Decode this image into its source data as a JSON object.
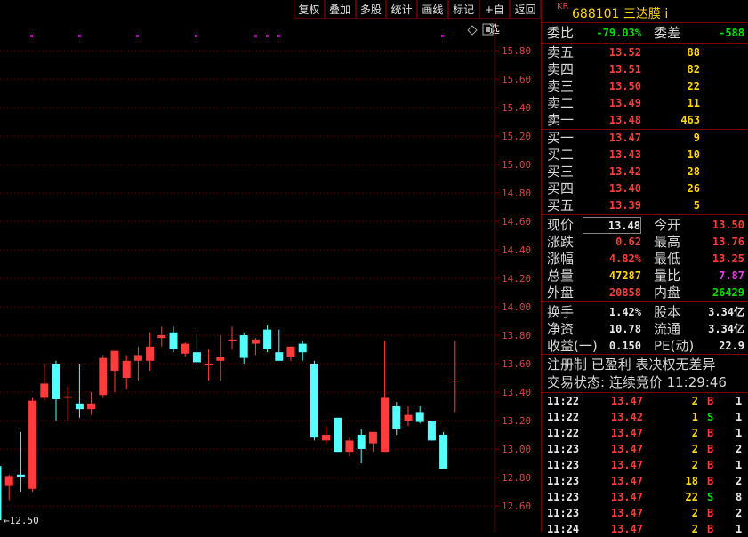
{
  "toolbar": {
    "buttons": [
      "复权",
      "叠加",
      "多股",
      "统计",
      "画线",
      "标记",
      "+自选",
      "返回"
    ]
  },
  "colors": {
    "up": "#ff3b3b",
    "down": "#54ffff",
    "grid": "#7a0000",
    "marker": "#c000c0"
  },
  "chart_data": {
    "type": "candlestick",
    "y_axis_labels": [
      "15.80",
      "15.60",
      "15.40",
      "15.20",
      "15.00",
      "14.80",
      "14.60",
      "14.40",
      "14.20",
      "14.00",
      "13.80",
      "13.60",
      "13.40",
      "13.20",
      "13.00",
      "12.80",
      "12.60"
    ],
    "ylim": [
      12.5,
      15.9
    ],
    "low_marker": "12.50",
    "candles": [
      {
        "o": 12.88,
        "h": 13.2,
        "l": 12.7,
        "c": 12.5
      },
      {
        "o": 12.74,
        "h": 12.82,
        "l": 12.64,
        "c": 12.81
      },
      {
        "o": 12.82,
        "h": 13.12,
        "l": 12.7,
        "c": 12.8
      },
      {
        "o": 12.72,
        "h": 13.36,
        "l": 12.7,
        "c": 13.34
      },
      {
        "o": 13.36,
        "h": 13.6,
        "l": 13.34,
        "c": 13.46
      },
      {
        "o": 13.6,
        "h": 13.62,
        "l": 13.2,
        "c": 13.35
      },
      {
        "o": 13.36,
        "h": 13.44,
        "l": 13.2,
        "c": 13.37
      },
      {
        "o": 13.32,
        "h": 13.6,
        "l": 13.22,
        "c": 13.28
      },
      {
        "o": 13.28,
        "h": 13.4,
        "l": 13.24,
        "c": 13.32
      },
      {
        "o": 13.38,
        "h": 13.66,
        "l": 13.36,
        "c": 13.64
      },
      {
        "o": 13.55,
        "h": 13.68,
        "l": 13.4,
        "c": 13.69
      },
      {
        "o": 13.5,
        "h": 13.66,
        "l": 13.42,
        "c": 13.62
      },
      {
        "o": 13.62,
        "h": 13.72,
        "l": 13.48,
        "c": 13.66
      },
      {
        "o": 13.62,
        "h": 13.82,
        "l": 13.55,
        "c": 13.72
      },
      {
        "o": 13.78,
        "h": 13.86,
        "l": 13.72,
        "c": 13.8
      },
      {
        "o": 13.82,
        "h": 13.86,
        "l": 13.68,
        "c": 13.7
      },
      {
        "o": 13.67,
        "h": 13.75,
        "l": 13.65,
        "c": 13.74
      },
      {
        "o": 13.68,
        "h": 13.82,
        "l": 13.6,
        "c": 13.61
      },
      {
        "o": 13.6,
        "h": 13.7,
        "l": 13.48,
        "c": 13.6
      },
      {
        "o": 13.62,
        "h": 13.8,
        "l": 13.48,
        "c": 13.65
      },
      {
        "o": 13.76,
        "h": 13.86,
        "l": 13.7,
        "c": 13.77
      },
      {
        "o": 13.8,
        "h": 13.82,
        "l": 13.6,
        "c": 13.64
      },
      {
        "o": 13.74,
        "h": 13.78,
        "l": 13.66,
        "c": 13.77
      },
      {
        "o": 13.84,
        "h": 13.87,
        "l": 13.68,
        "c": 13.7
      },
      {
        "o": 13.68,
        "h": 13.84,
        "l": 13.62,
        "c": 13.62
      },
      {
        "o": 13.65,
        "h": 13.72,
        "l": 13.62,
        "c": 13.72
      },
      {
        "o": 13.74,
        "h": 13.76,
        "l": 13.62,
        "c": 13.68
      },
      {
        "o": 13.6,
        "h": 13.62,
        "l": 13.06,
        "c": 13.08
      },
      {
        "o": 13.06,
        "h": 13.16,
        "l": 13.04,
        "c": 13.1
      },
      {
        "o": 13.22,
        "h": 13.22,
        "l": 12.98,
        "c": 12.98
      },
      {
        "o": 12.98,
        "h": 13.08,
        "l": 12.95,
        "c": 13.06
      },
      {
        "o": 13.1,
        "h": 13.14,
        "l": 12.9,
        "c": 13.0
      },
      {
        "o": 13.04,
        "h": 13.12,
        "l": 12.98,
        "c": 13.12
      },
      {
        "o": 12.98,
        "h": 13.76,
        "l": 12.98,
        "c": 13.36
      },
      {
        "o": 13.3,
        "h": 13.33,
        "l": 13.1,
        "c": 13.14
      },
      {
        "o": 13.2,
        "h": 13.3,
        "l": 13.16,
        "c": 13.24
      },
      {
        "o": 13.26,
        "h": 13.3,
        "l": 13.18,
        "c": 13.19
      },
      {
        "o": 13.2,
        "h": 13.2,
        "l": 13.06,
        "c": 13.06
      },
      {
        "o": 13.1,
        "h": 13.12,
        "l": 12.86,
        "c": 12.86
      },
      {
        "o": 13.48,
        "h": 13.76,
        "l": 13.26,
        "c": 13.48
      }
    ]
  },
  "quote": {
    "kr": "KR",
    "code_name": "688101 三达膜 i",
    "weibi_label": "委比",
    "weibi": "-79.03%",
    "weicha_label": "委差",
    "weicha": "-588",
    "asks": [
      {
        "label": "卖五",
        "price": "13.52",
        "vol": "88"
      },
      {
        "label": "卖四",
        "price": "13.51",
        "vol": "82"
      },
      {
        "label": "卖三",
        "price": "13.50",
        "vol": "22"
      },
      {
        "label": "卖二",
        "price": "13.49",
        "vol": "11"
      },
      {
        "label": "卖一",
        "price": "13.48",
        "vol": "463"
      }
    ],
    "bids": [
      {
        "label": "买一",
        "price": "13.47",
        "vol": "9"
      },
      {
        "label": "买二",
        "price": "13.43",
        "vol": "10"
      },
      {
        "label": "买三",
        "price": "13.42",
        "vol": "28"
      },
      {
        "label": "买四",
        "price": "13.40",
        "vol": "26"
      },
      {
        "label": "买五",
        "price": "13.39",
        "vol": "5"
      }
    ],
    "stats": [
      {
        "l1": "现价",
        "v1": "13.48",
        "l2": "今开",
        "v2": "13.50"
      },
      {
        "l1": "涨跌",
        "v1": "0.62",
        "l2": "最高",
        "v2": "13.76"
      },
      {
        "l1": "涨幅",
        "v1": "4.82%",
        "l2": "最低",
        "v2": "13.25"
      },
      {
        "l1": "总量",
        "v1": "47287",
        "l2": "量比",
        "v2": "7.87"
      },
      {
        "l1": "外盘",
        "v1": "20858",
        "l2": "内盘",
        "v2": "26429"
      }
    ],
    "fund": [
      {
        "l1": "换手",
        "v1": "1.42%",
        "l2": "股本",
        "v2": "3.34亿"
      },
      {
        "l1": "净资",
        "v1": "10.78",
        "l2": "流通",
        "v2": "3.34亿"
      },
      {
        "l1": "收益(一)",
        "v1": "0.150",
        "l2": "PE(动)",
        "v2": "22.9"
      }
    ],
    "notice": "注册制 已盈利 表决权无差异",
    "status": "交易状态: 连续竞价 11:29:46"
  },
  "ticks": [
    {
      "t": "11:22",
      "p": "13.47",
      "v": "2",
      "s": "B",
      "n": "1"
    },
    {
      "t": "11:22",
      "p": "13.42",
      "v": "1",
      "s": "S",
      "n": "1"
    },
    {
      "t": "11:22",
      "p": "13.47",
      "v": "2",
      "s": "B",
      "n": "1"
    },
    {
      "t": "11:23",
      "p": "13.47",
      "v": "2",
      "s": "B",
      "n": "2"
    },
    {
      "t": "11:23",
      "p": "13.47",
      "v": "2",
      "s": "B",
      "n": "1"
    },
    {
      "t": "11:23",
      "p": "13.47",
      "v": "18",
      "s": "B",
      "n": "2"
    },
    {
      "t": "11:23",
      "p": "13.47",
      "v": "22",
      "s": "S",
      "n": "8"
    },
    {
      "t": "11:23",
      "p": "13.47",
      "v": "2",
      "s": "B",
      "n": "2"
    },
    {
      "t": "11:24",
      "p": "13.47",
      "v": "2",
      "s": "B",
      "n": "1"
    }
  ]
}
